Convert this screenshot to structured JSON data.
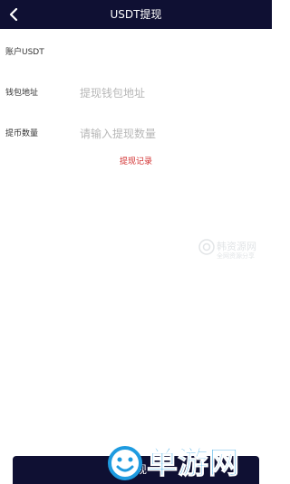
{
  "header": {
    "title": "USDT提现"
  },
  "account_label": "账户USDT",
  "wallet": {
    "label": "钱包地址",
    "placeholder": "提现钱包地址"
  },
  "amount": {
    "label": "提币数量",
    "placeholder": "请输入提现数量"
  },
  "record_link": "提现记录",
  "submit_label": "提现",
  "watermark_small": {
    "title": "韩资源网",
    "subtitle": "全网资源分享"
  },
  "watermark_large": {
    "text": "单游网"
  },
  "colors": {
    "header_bg": "#0f1033",
    "link_red": "#d12c2c",
    "placeholder": "#b7b7b7",
    "watermark_blue": "#1e9be0"
  },
  "icons": {
    "back": "chevron-left-icon",
    "watermark_small_logo": "watermark-logo-icon",
    "watermark_large_logo": "smiley-logo-icon"
  }
}
